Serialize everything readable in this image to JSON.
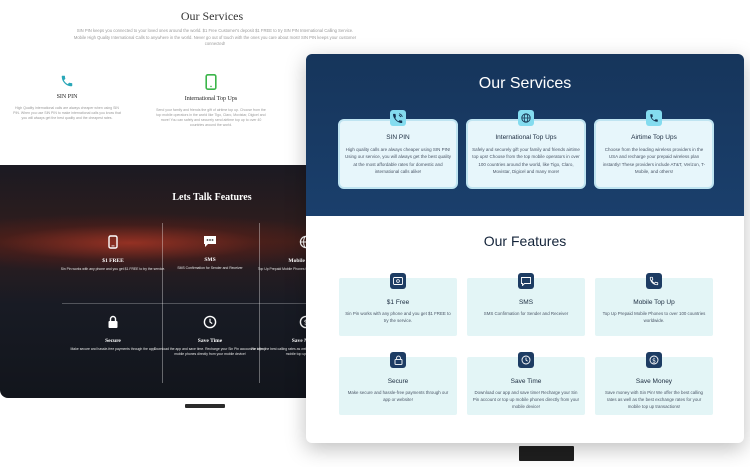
{
  "back": {
    "title": "Our Services",
    "intro": "SIN PIN keeps you connected to your loved ones around the world. $1 Free Customer's deposit $1 FREE to try SIN PIN International Calling Service. Mobile High Quality International Calls to anywhere in the world. Never go out of touch with the ones you care about most! SIN PIN keeps your customer connected!",
    "services": [
      {
        "title": "SIN PIN",
        "desc": "High Quality international calls are always cheaper when using SIN PIN. When you use SIN PIN to make international calls you know that you will always get the best quality and the cheapest rates.",
        "icon": "phone-icon"
      },
      {
        "title": "International Top Ups",
        "desc": "Send your family and friends the gift of airtime top up. Choose from the top mobile operators in the world like Tigo, Claro, Movistar, Digicel and more! You can safely and securely send airtime top up to over 40 countries around the world.",
        "icon": "mobile-icon"
      }
    ],
    "features_title": "Lets Talk Features",
    "features": [
      {
        "title": "$1 FREE",
        "desc": "Sin Pin works with any phone and you get $1 FREE to try the service.",
        "icon": "phone-device-icon"
      },
      {
        "title": "SMS",
        "desc": "SMS Confirmation for Sender and Receiver",
        "icon": "sms-icon"
      },
      {
        "title": "Mobile Top Up",
        "desc": "Top Up Prepaid Mobile Phones to over 100 countries worldwide.",
        "icon": "globe-icon"
      },
      {
        "title": "Secure",
        "desc": "Make secure and hassle-free payments through the app!",
        "icon": "lock-icon"
      },
      {
        "title": "Save Time",
        "desc": "Download the app and save time. Recharge your Sin Pin account or top up mobile phones directly from your mobile device!",
        "icon": "clock-icon"
      },
      {
        "title": "Save Money",
        "desc": "We offer the best calling rates as well as the best exchange rates for your mobile top up transactions!",
        "icon": "money-icon"
      }
    ]
  },
  "front": {
    "services_title": "Our Services",
    "services": [
      {
        "title": "SIN PIN",
        "desc": "High quality calls are always cheaper using SIN PIN! Using our service, you will always get the best quality at the most affordable rates for domestic and international calls alike!",
        "icon": "wifi-phone-icon"
      },
      {
        "title": "International Top Ups",
        "desc": "Safely and securely gift your family and friends airtime top ups! Choose from the top mobile operators in over 100 countries around the world, like Tigo, Claro, Movistar, Digicel and many more!",
        "icon": "globe-icon"
      },
      {
        "title": "Airtime Top Ups",
        "desc": "Choose from the leading wireless providers in the USA and recharge your prepaid wireless plan instantly! These providers include AT&T, Verizon, T-Mobile, and others!",
        "icon": "phone-icon"
      }
    ],
    "features_title": "Our Features",
    "features": [
      {
        "title": "$1 Free",
        "desc": "Sin Pin works with any phone and you get $1 FREE to try the service.",
        "icon": "money-card-icon"
      },
      {
        "title": "SMS",
        "desc": "SMS Confirmation for Sender and Receiver",
        "icon": "chat-icon"
      },
      {
        "title": "Mobile Top Up",
        "desc": "Top Up Prepaid Mobile Phones to over 100 countries worldwide.",
        "icon": "phone-icon"
      },
      {
        "title": "Secure",
        "desc": "Make secure and hassle-free payments through our app or website!",
        "icon": "lock-icon"
      },
      {
        "title": "Save Time",
        "desc": "Download our app and save time! Recharge your Sin Pin account or top up mobile phones directly from your mobile device!",
        "icon": "clock-icon"
      },
      {
        "title": "Save Money",
        "desc": "Save money with Sin Pin! We offer the best calling rates as well as the best exchange rates for your mobile top up transactions!",
        "icon": "dollar-icon"
      }
    ]
  },
  "colors": {
    "navy": "#1a3f6c",
    "card_bg": "#e7f6fb",
    "card_icon": "#84dcef",
    "feature_bg": "#e3f5f6",
    "back_icon_teal": "#2aa7b8",
    "back_icon_green": "#3bb54a"
  }
}
